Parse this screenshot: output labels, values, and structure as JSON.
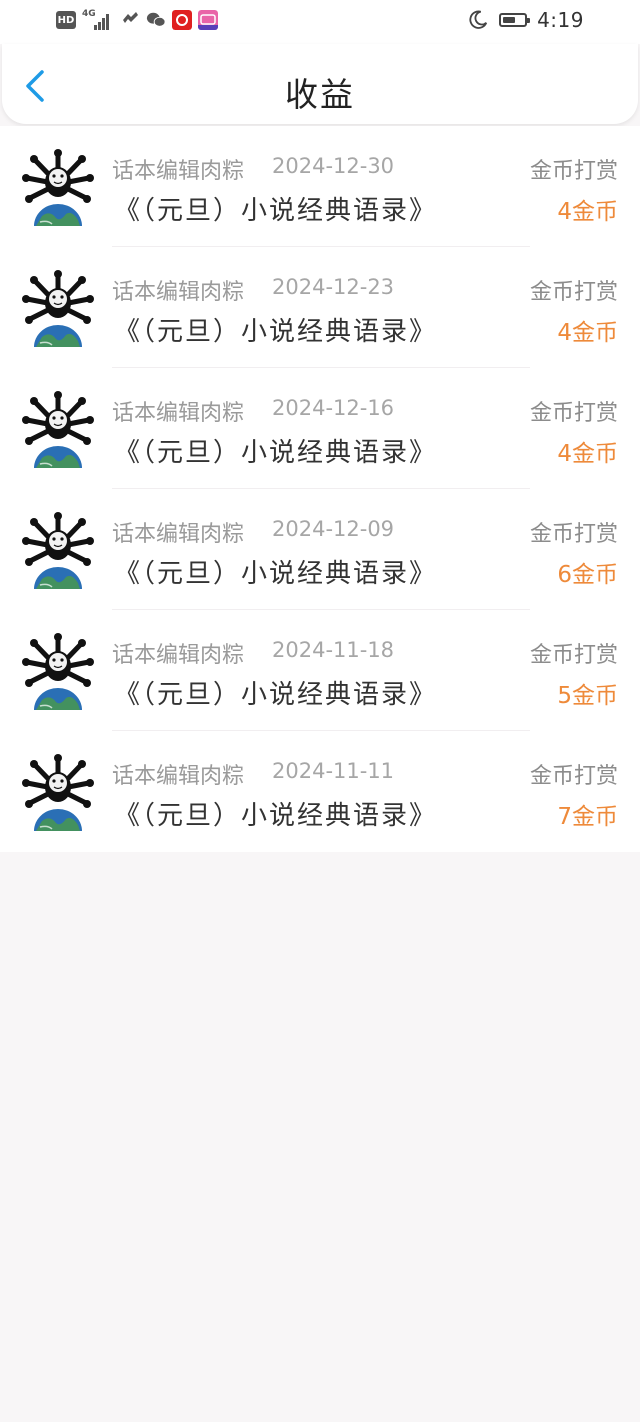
{
  "status_bar": {
    "badge": "HD",
    "network": "4G",
    "time": "4:19",
    "battery_level": 0.6
  },
  "header": {
    "title": "收益"
  },
  "records": [
    {
      "user": "话本编辑肉粽",
      "date": "2024-12-30",
      "type": "金币打赏",
      "book": "《（元旦）小说经典语录》",
      "amount": "4金币"
    },
    {
      "user": "话本编辑肉粽",
      "date": "2024-12-23",
      "type": "金币打赏",
      "book": "《（元旦）小说经典语录》",
      "amount": "4金币"
    },
    {
      "user": "话本编辑肉粽",
      "date": "2024-12-16",
      "type": "金币打赏",
      "book": "《（元旦）小说经典语录》",
      "amount": "4金币"
    },
    {
      "user": "话本编辑肉粽",
      "date": "2024-12-09",
      "type": "金币打赏",
      "book": "《（元旦）小说经典语录》",
      "amount": "6金币"
    },
    {
      "user": "话本编辑肉粽",
      "date": "2024-11-18",
      "type": "金币打赏",
      "book": "《（元旦）小说经典语录》",
      "amount": "5金币"
    },
    {
      "user": "话本编辑肉粽",
      "date": "2024-11-11",
      "type": "金币打赏",
      "book": "《（元旦）小说经典语录》",
      "amount": "7金币"
    }
  ],
  "colors": {
    "accent": "#1e9be6",
    "amount": "#ee8a3a"
  },
  "icons": {
    "back": "chevron-left-icon",
    "moon": "moon-icon",
    "battery": "battery-icon"
  }
}
